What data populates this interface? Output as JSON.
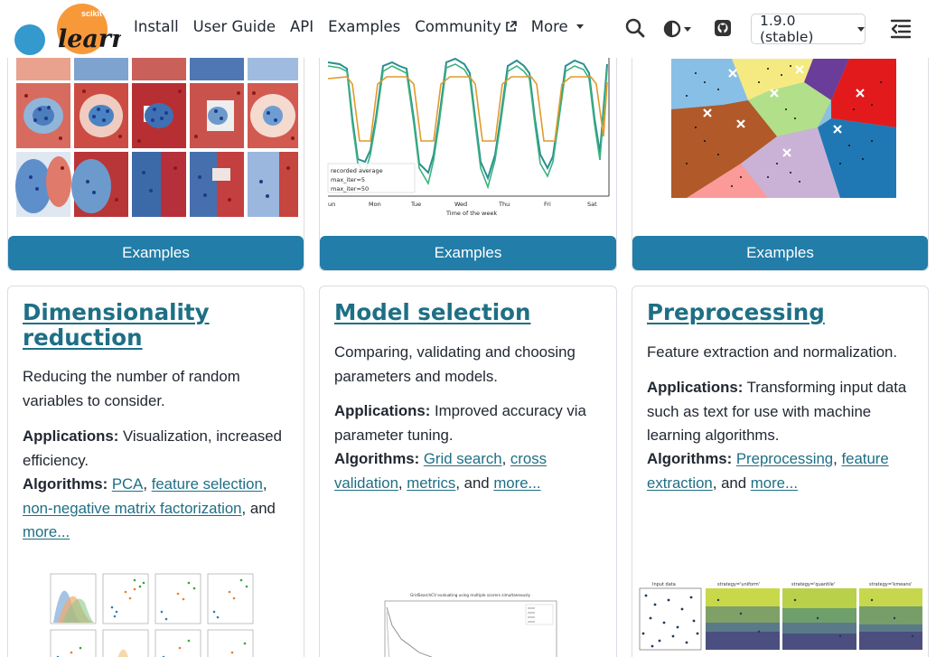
{
  "nav": {
    "logo_small": "scikit",
    "logo_big": "learn",
    "links": [
      "Install",
      "User Guide",
      "API",
      "Examples",
      "Community",
      "More"
    ],
    "version": "1.9.0 (stable)"
  },
  "top_cards": [
    {
      "button": "Examples",
      "legend": [
        "recorded average",
        "max_iter=5",
        "max_iter=50"
      ],
      "x_ticks": [
        "un",
        "Mon",
        "Tue",
        "Wed",
        "Thu",
        "Fri",
        "Sat"
      ],
      "x_label": "Time of the week"
    },
    {
      "button": "Examples"
    },
    {
      "button": "Examples"
    }
  ],
  "cards": [
    {
      "title": "Dimensionality reduction",
      "description": "Reducing the number of random variables to consider.",
      "apps_label": "Applications:",
      "apps_text": "Visualization, increased efficiency.",
      "algs_label": "Algorithms:",
      "links": [
        "PCA",
        "feature selection",
        "non-negative matrix factorization"
      ],
      "sep": ", ",
      "and": ", and",
      "more": "more..."
    },
    {
      "title": "Model selection",
      "description": "Comparing, validating and choosing parameters and models.",
      "apps_label": "Applications:",
      "apps_text": "Improved accuracy via parameter tuning.",
      "algs_label": "Algorithms:",
      "links": [
        "Grid search",
        "cross validation",
        "metrics"
      ],
      "sep": ", ",
      "and": ", and",
      "more": "more...",
      "thumb_title": "GridSearchCV evaluating using multiple scorers simultaneously"
    },
    {
      "title": "Preprocessing",
      "description": "Feature extraction and normalization.",
      "apps_label": "Applications:",
      "apps_text": "Transforming input data such as text for use with machine learning algorithms.",
      "algs_label": "Algorithms:",
      "links": [
        "Preprocessing",
        "feature extraction"
      ],
      "sep": ", ",
      "and": ", and",
      "more": "more...",
      "thumb_titles": [
        "Input data",
        "strategy='uniform'",
        "strategy='quantile'",
        "strategy='kmeans'"
      ]
    }
  ],
  "colors": {
    "accent": "#227da8",
    "link": "#1e6f85",
    "text": "#222832"
  }
}
